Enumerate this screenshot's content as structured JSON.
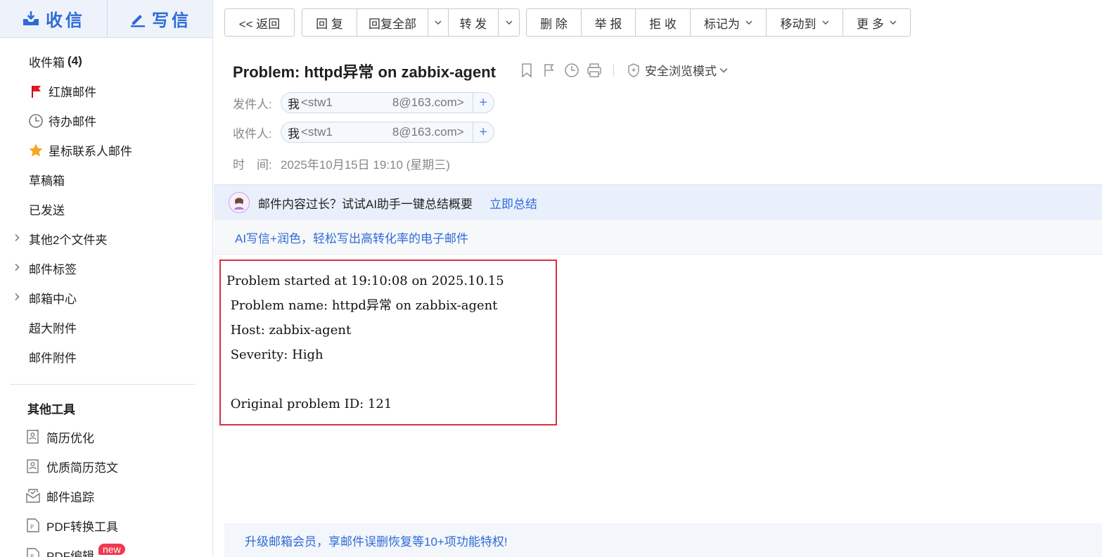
{
  "sidebar": {
    "receive_label": "收信",
    "write_label": "写信",
    "nav": {
      "inbox_label": "收件箱",
      "inbox_count": "(4)",
      "red_flag_label": "红旗邮件",
      "todo_label": "待办邮件",
      "star_contacts_label": "星标联系人邮件",
      "drafts_label": "草稿箱",
      "sent_label": "已发送",
      "other_folders_label": "其他2个文件夹",
      "tags_label": "邮件标签",
      "mailbox_center_label": "邮箱中心",
      "large_attach_label": "超大附件",
      "mail_attach_label": "邮件附件"
    },
    "tools_heading": "其他工具",
    "tools": {
      "resume_opt": "简历优化",
      "resume_samples": "优质简历范文",
      "mail_track": "邮件追踪",
      "pdf_convert": "PDF转换工具",
      "pdf_edit": "PDF编辑",
      "new_badge": "new"
    }
  },
  "toolbar": {
    "back": "<< 返回",
    "reply": "回 复",
    "reply_all": "回复全部",
    "forward": "转 发",
    "delete": "删 除",
    "report": "举 报",
    "reject": "拒 收",
    "mark_as": "标记为",
    "move_to": "移动到",
    "more": "更 多"
  },
  "mail": {
    "subject": "Problem: httpd异常 on zabbix-agent",
    "safe_mode_label": "安全浏览模式",
    "from_label": "发件人:",
    "from_name": "我",
    "from_addr": "<stw1     8@163.com>",
    "to_label": "收件人:",
    "to_name": "我",
    "to_addr": "<stw1     8@163.com>",
    "time_label": "时　间:",
    "time_value": "2025年10月15日 19:10 (星期三)",
    "body_lines": [
      "Problem started at 19:10:08 on 2025.10.15",
      " Problem name: httpd异常 on zabbix-agent",
      " Host: zabbix-agent",
      " Severity: High",
      "",
      " Original problem ID: 121"
    ]
  },
  "ai": {
    "prompt": "邮件内容过长？试试AI助手一键总结概要",
    "summarize_link": "立即总结",
    "write_promo": "AI写信+润色，轻松写出高转化率的电子邮件"
  },
  "upgrade_banner": "升级邮箱会员，享邮件误删恢复等10+项功能特权!",
  "colors": {
    "accent": "#2f6bd8",
    "highlight_border": "#d9303a",
    "ai_bar_bg": "#e9f0fc",
    "new_badge": "#f0394f"
  }
}
